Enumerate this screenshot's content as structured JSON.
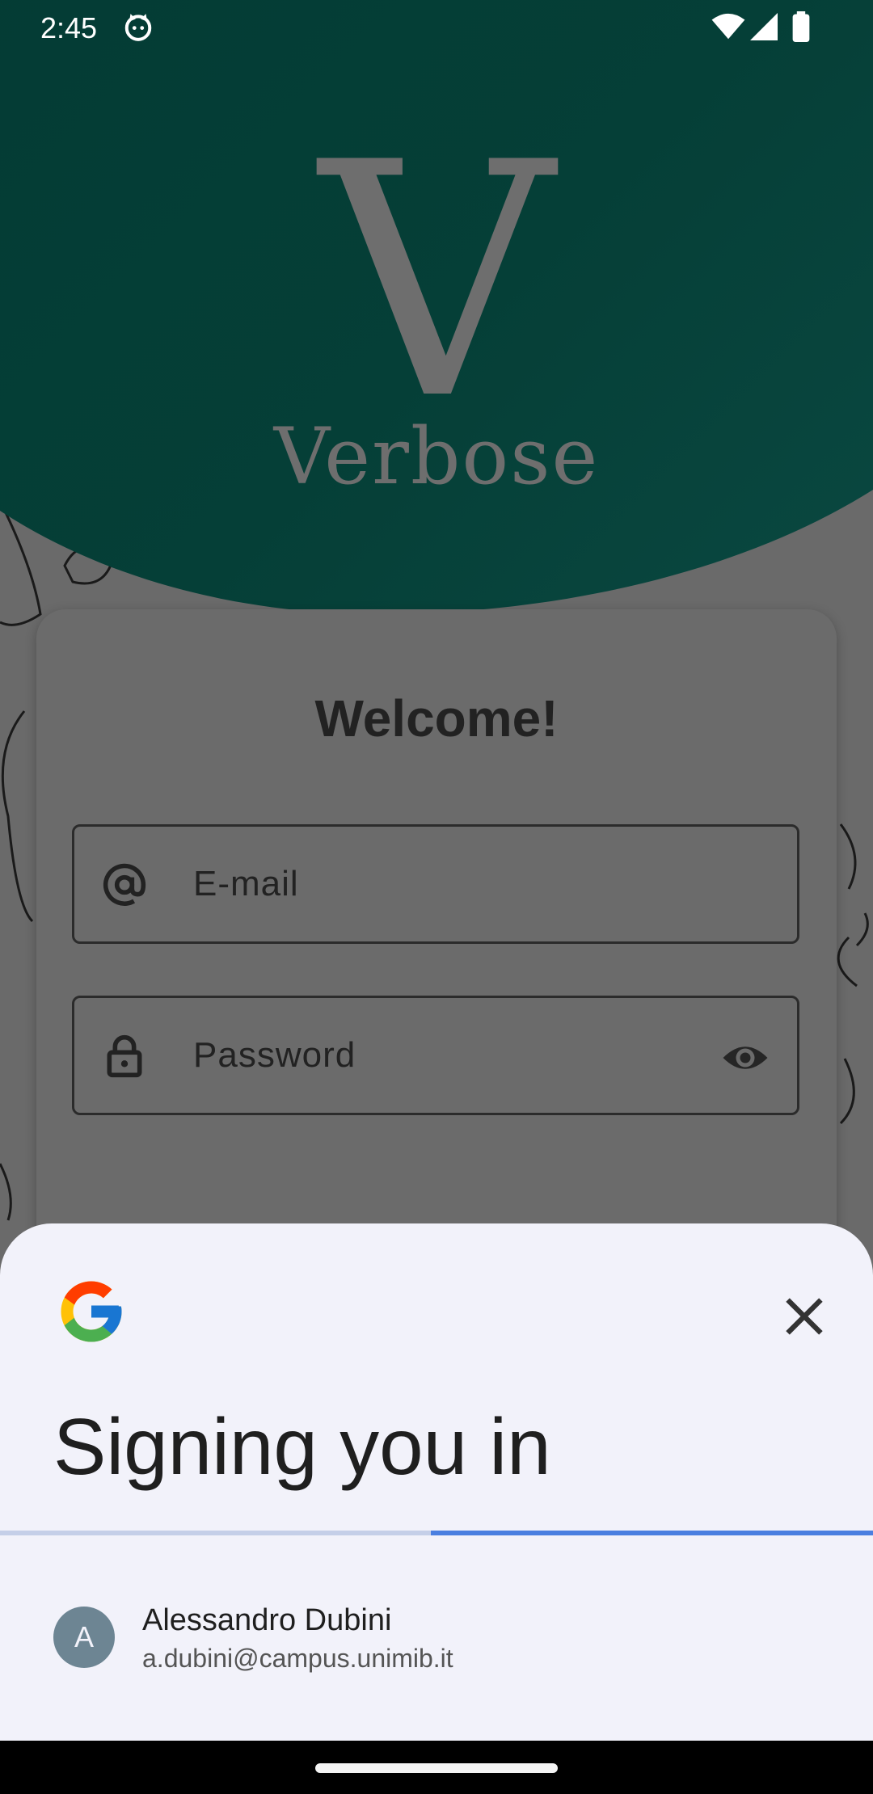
{
  "status_bar": {
    "time": "2:45",
    "icons": [
      "cat-icon",
      "wifi-icon",
      "signal-icon",
      "battery-icon"
    ]
  },
  "app": {
    "logo_letter": "V",
    "logo_name": "Verbose",
    "colors": {
      "hero": "#033a33",
      "card": "#6b6b6b"
    }
  },
  "login_card": {
    "title": "Welcome!",
    "email_placeholder": "E-mail",
    "password_placeholder": "Password",
    "icons": [
      "at-sign-icon",
      "lock-icon",
      "eye-icon"
    ]
  },
  "signin_sheet": {
    "title": "Signing you in",
    "icons": [
      "google-logo-icon",
      "close-icon"
    ],
    "progress": 0.5,
    "account": {
      "initial": "A",
      "name": "Alessandro Dubini",
      "email": "a.dubini@campus.unimib.it"
    },
    "colors": {
      "sheet_bg": "#f2f2fa",
      "progress": "#4a7fe0",
      "avatar": "#6d8593"
    }
  }
}
